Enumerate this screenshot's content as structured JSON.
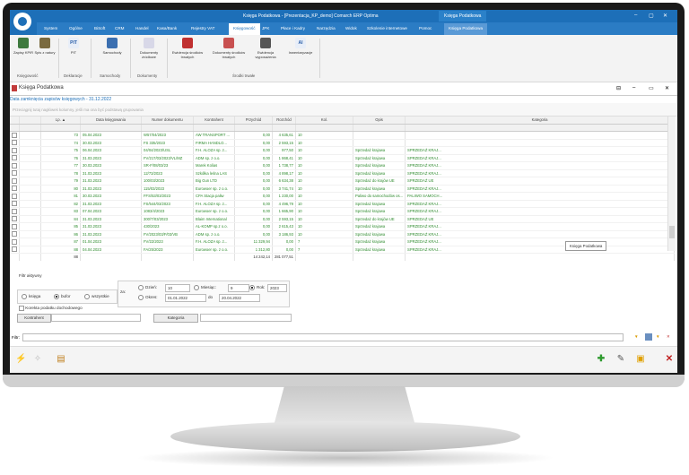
{
  "titlebar": {
    "title": "Księga Podatkowa - [Prezentacja_KP_demo] Comarch ERP Optima",
    "context_title": "Księga Podatkowa"
  },
  "menu": [
    "System",
    "Ogólne",
    "BiSoft",
    "CRM",
    "Handel",
    "Kasa/Bank",
    "Rejestry VAT",
    "Księgowość",
    "JPK",
    "Płace i Kadry",
    "Narzędzia",
    "Widok",
    "Szkolenie internetowe",
    "Pomoc",
    "Księga Podatkowa"
  ],
  "ribbon": {
    "buttons": [
      "Zapisy KPiR",
      "Spis z natury",
      "PIT",
      "Samochody",
      "Dokumenty źródłowe",
      "Ewidencja środków trwałych",
      "Dokumenty środków trwałych",
      "Ewidencja wyposażenia",
      "Inwentaryzacje"
    ],
    "pit_icon": "PIT",
    "ai_icon": "AI",
    "groups": [
      "Księgowość",
      "Deklaracje",
      "Samochody",
      "Dokumenty",
      "Środki trwałe"
    ]
  },
  "window": {
    "title": "Księga Podatkowa",
    "closing_date": "Data zamknięcia zapisów księgowych - 31.12.2022",
    "group_hint": "Przeciągnij tutaj nagłówek kolumny, jeśli ma ona być podstawą grupowania"
  },
  "grid": {
    "headers": [
      "Lp. ▲",
      "Data księgowania",
      "Numer dokumentu",
      "Kontrahent",
      "Przychód",
      "Rozchód",
      "Kol.",
      "Opis",
      "Kategoria"
    ],
    "rows": [
      [
        "73",
        "05.04.2023",
        "W57/04/2023",
        "AW TRANSPORT ...",
        "0,00",
        "4 635,61",
        "10",
        "",
        ""
      ],
      [
        "74",
        "30.03.2023",
        "FS 335/2023",
        "FIRMA HANDLO...",
        "0,00",
        "2 593,15",
        "10",
        "",
        ""
      ],
      [
        "75",
        "06.04.2023",
        "04/04/2023/USL",
        "F.H. ALOZA sp. z...",
        "0,00",
        "977,50",
        "10",
        "Sprzedaż krajowa",
        "SPRZEDAŻ KRAJ..."
      ],
      [
        "76",
        "31.03.2023",
        "FV/217/03/2023/VL/MZ",
        "ADM sp. z o.o.",
        "0,00",
        "1 868,41",
        "10",
        "Sprzedaż krajowa",
        "SPRZEDAŻ KRAJ..."
      ],
      [
        "77",
        "30.03.2023",
        "SR-F/08/03/23",
        "Marek Kolias",
        "0,00",
        "1 738,77",
        "10",
        "Sprzedaż krajowa",
        "SPRZEDAŻ KRAJ..."
      ],
      [
        "78",
        "31.03.2023",
        "12/73/2023",
        "Szkółka leśna LAS",
        "0,00",
        "4 898,17",
        "10",
        "Sprzedaż krajowa",
        "SPRZEDAŻ KRAJ..."
      ],
      [
        "79",
        "31.03.2023",
        "100/03/2023",
        "Big Gun LTD",
        "0,00",
        "6 634,38",
        "10",
        "Sprzedaż do krajów UE",
        "SPRZEDAŻ UE"
      ],
      [
        "80",
        "31.03.2023",
        "115/03/2023",
        "Eurowoer sp. z o.o.",
        "0,00",
        "3 741,74",
        "10",
        "Sprzedaż krajowa",
        "SPRZEDAŻ KRAJ..."
      ],
      [
        "81",
        "30.03.2023",
        "FFS/53/03/2023",
        "CPA Stacja paliw",
        "0,00",
        "1 230,00",
        "10",
        "Paliwo do samochodów os...",
        "PALIWO SAMOCH..."
      ],
      [
        "82",
        "31.03.2023",
        "FS/544/03/2023",
        "F.H. ALOZA sp. z...",
        "0,00",
        "4 496,79",
        "10",
        "Sprzedaż krajowa",
        "SPRZEDAŻ KRAJ..."
      ],
      [
        "83",
        "07.04.2023",
        "1083/4/2023",
        "Eurowoer sp. z o.o.",
        "0,00",
        "1 665,90",
        "10",
        "Sprzedaż krajowa",
        "SPRZEDAŻ KRAJ..."
      ],
      [
        "84",
        "31.03.2023",
        "300/T/03/2023",
        "Blaim International",
        "0,00",
        "2 593,15",
        "10",
        "Sprzedaż do krajów UE",
        "SPRZEDAŻ UE"
      ],
      [
        "85",
        "31.03.2023",
        "430/2023",
        "AL-KOMP sp.z o.o.",
        "0,00",
        "2 615,43",
        "10",
        "Sprzedaż krajowa",
        "SPRZEDAŻ KRAJ..."
      ],
      [
        "86",
        "31.03.2023",
        "FV/2023/03/F/03/VB",
        "ADM sp. z o.o.",
        "0,00",
        "3 186,93",
        "10",
        "Sprzedaż krajowa",
        "SPRZEDAŻ KRAJ..."
      ],
      [
        "87",
        "01.04.2023",
        "FV/22/2023",
        "F.H. ALOZA sp. z...",
        "11 329,94",
        "0,00",
        "7",
        "Sprzedaż krajowa",
        "SPRZEDAŻ KRAJ..."
      ],
      [
        "88",
        "04.04.2023",
        "FA/25/2023",
        "Eurowoer sp. z o.o.",
        "1 312,80",
        "0,00",
        "7",
        "Sprzedaż krajowa",
        "SPRZEDAŻ KRAJ..."
      ]
    ],
    "summary": {
      "count": "88",
      "income": "14 242,14",
      "expense": "281 077,51"
    }
  },
  "tooltip": "Księga Podatkowa",
  "filter": {
    "title": "Filtr aktywny",
    "radios": [
      "księga",
      "bufor",
      "wszystkie"
    ],
    "za_label": "za:",
    "dzien_label": "Dzień:",
    "dzien_value": "10",
    "miesiac_label": "Miesiąc:",
    "miesiac_value": "9",
    "rok_label": "Rok:",
    "rok_value": "2023",
    "okres_label": "Okres:",
    "okres_from": "01.01.2022",
    "okres_to_label": "do",
    "okres_to": "20.04.2022",
    "korekta_label": "Korekta podatku dochodowego",
    "kontrahent_btn": "Kontrahent",
    "kategoria_btn": "Kategoria",
    "filtr_label": "Filtr:"
  }
}
